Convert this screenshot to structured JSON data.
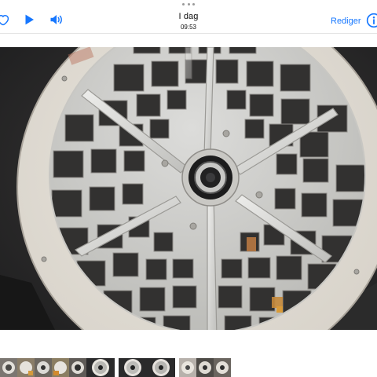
{
  "header": {
    "title": "I dag",
    "time": "09:53",
    "edit_label": "Rediger"
  },
  "icons": {
    "favorite": "heart-outline-icon",
    "play": "play-icon",
    "sound": "speaker-icon",
    "info": "info-icon",
    "more": "more-dots-icon"
  },
  "colors": {
    "accent": "#1677ff",
    "photo_bg": "#262526"
  },
  "photo": {
    "subject": "speaker grille"
  },
  "thumbnails": {
    "count": 13
  }
}
